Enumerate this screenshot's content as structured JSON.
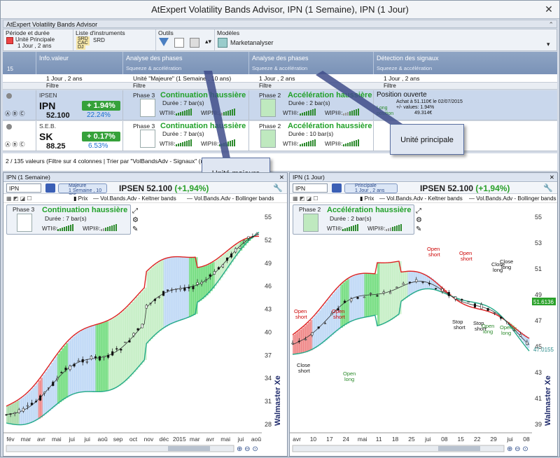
{
  "window": {
    "title": "AtExpert Volatility Bands Advisor, IPN (1 Semaine), IPN (1 Jour)",
    "close": "✕"
  },
  "app": {
    "subtitle": "AtExpert Volatility Bands Advisor"
  },
  "ribbon": {
    "periode": {
      "label": "Période et durée",
      "unit": "Unité Principale",
      "unit_value": "1 Jour , 2 ans"
    },
    "liste": {
      "label": "Liste d'instruments",
      "items": [
        "SRD",
        "CAC",
        "DJ"
      ],
      "item_top": "SRD"
    },
    "outils": {
      "label": "Outils"
    },
    "modeles": {
      "label": "Modèles",
      "value": "Marketanalyser"
    }
  },
  "columns": [
    {
      "title": "Info.valeur",
      "sub": ""
    },
    {
      "title": "Analyse des phases",
      "sub": "Squeeze & accélération"
    },
    {
      "title": "Analyse des phases",
      "sub": "Squeeze & accélération"
    },
    {
      "title": "Détection des signaux",
      "sub": "Squeeze & accélération"
    }
  ],
  "rowcount": "15",
  "selectors": [
    "1 Jour , 2 ans",
    "Unité \"Majeure\" (1 Semaine , 10 ans)",
    "1 Jour , 2 ans",
    "1 Jour , 2 ans"
  ],
  "filter_label": "Filtre",
  "rows": [
    {
      "company": "IPSEN",
      "ticker": "IPN",
      "price": "52.100",
      "change": "1.94%",
      "pct": "22.24%",
      "p1_label": "Phase 3",
      "p1_name": "Continuation haussière",
      "p1_dur": "Durée :  7 bar(s)",
      "p2_label": "Phase 2",
      "p2_name": "Accélération haussière",
      "p2_dur": "Durée :  2 bar(s)",
      "wti": "WTI®:",
      "wipi": "WIPI®:",
      "sig_title": "Position ouverte",
      "sig_l1": "Achat à 51.110€ le 02/07/2015",
      "sig_l2": "+/- values:  1.94%",
      "sig_l3": "49.314€",
      "sig_tag": "Long position"
    },
    {
      "company": "S.E.B.",
      "ticker": "SK",
      "price": "88.25",
      "change": "0.17%",
      "pct": "6.53%",
      "p1_label": "Phase 3",
      "p1_name": "Continuation haussière",
      "p1_dur": "Durée :  7 bar(s)",
      "p2_label": "Phase 2",
      "p2_name": "Accélération haussière",
      "p2_dur": "Durée :  10 bar(s)",
      "wti": "WTI®:",
      "wipi": "WIPI®:"
    }
  ],
  "status": "2 / 135 valeurs (Filtre sur 4 colonnes | Trier par \"VolBandsAdv - Signaux\" (résult",
  "callouts": {
    "majeure": "Unité majeure",
    "principale": "Unité principale"
  },
  "left": {
    "title": "IPN (1 Semaine)",
    "symbol": "IPN",
    "unit_top": "Majeure",
    "unit_bot": "1 Semaine , 10 ans",
    "quote_name": "IPSEN",
    "quote_price": "52.100",
    "quote_chg": "(+1,94%)",
    "legend": [
      "Prix",
      "Vol.Bands.Adv - Keltner bands",
      "Vol.Bands.Adv - Bollinger bands"
    ],
    "card": {
      "label": "Phase 3",
      "name": "Continuation haussière",
      "dur": "Durée :  7 bar(s)",
      "wti": "WTI®:",
      "wipi": "WIPI®:"
    },
    "yticks": [
      "55",
      "52",
      "49",
      "46",
      "43",
      "40",
      "37",
      "34",
      "31",
      "28"
    ],
    "xticks": [
      "fév",
      "mar",
      "avr",
      "mai",
      "jui",
      "jui",
      "aoû",
      "sep",
      "oct",
      "nov",
      "déc",
      "2015",
      "mar",
      "avr",
      "mai",
      "jui",
      "aoû"
    ],
    "brand": "Walmaster Xe"
  },
  "right": {
    "title": "IPN (1 Jour)",
    "symbol": "IPN",
    "unit_top": "Principale",
    "unit_bot": "1 Jour , 2 ans",
    "quote_name": "IPSEN",
    "quote_price": "52.100",
    "quote_chg": "(+1,94%)",
    "legend": [
      "Prix",
      "Vol.Bands.Adv - Keltner bands",
      "Vol.Bands.Adv - Bollinger bands"
    ],
    "card": {
      "label": "Phase 2",
      "name": "Accélération haussière",
      "dur": "Durée :  2 bar(s)",
      "wti": "WTI®:",
      "wipi": "WIPI®:"
    },
    "yticks": [
      "55",
      "53",
      "51",
      "49",
      "47",
      "45",
      "43",
      "41",
      "39"
    ],
    "last_price": "51.6136",
    "last_band": "47.0155",
    "xticks": [
      "avr",
      "10",
      "17",
      "24",
      "mai",
      "11",
      "18",
      "25",
      "jui",
      "08",
      "15",
      "22",
      "29",
      "jui",
      "08"
    ],
    "brand": "Walmaster Xe",
    "annotations": [
      "Open short",
      "Open short",
      "Close short",
      "Open long",
      "Open short",
      "Open short",
      "Stop short",
      "Stop short",
      "Close long",
      "Open long",
      "Open long",
      "Close long"
    ]
  },
  "colors": {
    "accent": "#7a92b7",
    "green": "#35a13a",
    "red": "#d9312c",
    "blue": "#1a6fd1"
  }
}
